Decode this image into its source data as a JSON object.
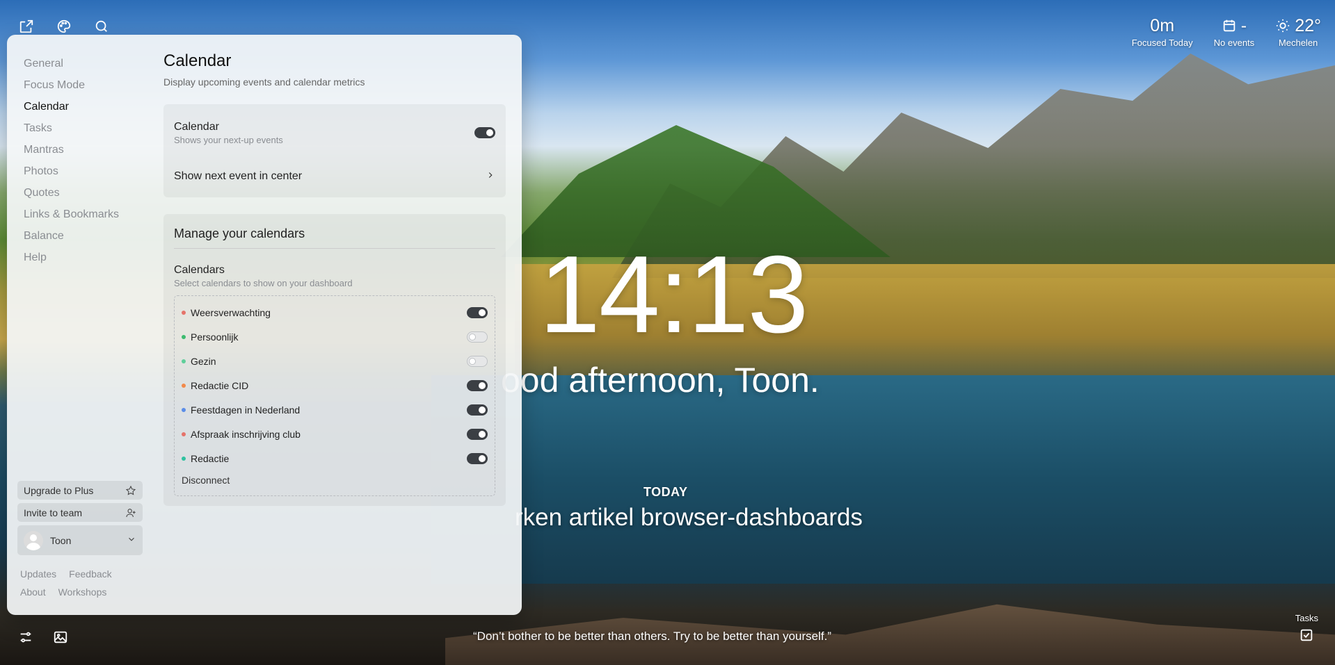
{
  "dashboard": {
    "clock": "14:13",
    "greeting": "ood afternoon, Toon.",
    "today_label": "TODAY",
    "focus_task": "rken artikel browser-dashboards",
    "quote": "“Don’t bother to be better than others. Try to be better than yourself.”",
    "tasks_label": "Tasks"
  },
  "widgets": {
    "focus": {
      "value": "0m",
      "label": "Focused Today"
    },
    "events": {
      "value": "-",
      "label": "No events",
      "icon": "calendar-icon"
    },
    "weather": {
      "value": "22°",
      "label": "Mechelen",
      "icon": "sun-icon"
    }
  },
  "nav": {
    "items": [
      {
        "label": "General"
      },
      {
        "label": "Focus Mode"
      },
      {
        "label": "Calendar"
      },
      {
        "label": "Tasks"
      },
      {
        "label": "Mantras"
      },
      {
        "label": "Photos"
      },
      {
        "label": "Quotes"
      },
      {
        "label": "Links & Bookmarks"
      },
      {
        "label": "Balance"
      },
      {
        "label": "Help"
      }
    ],
    "active": "Calendar"
  },
  "footer": {
    "upgrade": "Upgrade to Plus",
    "invite": "Invite to team",
    "user": "Toon",
    "links": [
      "Updates",
      "Feedback",
      "About",
      "Workshops"
    ]
  },
  "settings": {
    "title": "Calendar",
    "subtitle": "Display upcoming events and calendar metrics",
    "calendar_toggle": {
      "title": "Calendar",
      "subtitle": "Shows your next-up events",
      "on": true
    },
    "show_next": {
      "title": "Show next event in center"
    },
    "manage_title": "Manage your calendars",
    "calendars_title": "Calendars",
    "calendars_subtitle": "Select calendars to show on your dashboard",
    "calendars": [
      {
        "name": "Weersverwachting",
        "color": "#e5736a",
        "on": true
      },
      {
        "name": "Persoonlijk",
        "color": "#3dbb6f",
        "on": false
      },
      {
        "name": "Gezin",
        "color": "#5fcf9a",
        "on": false
      },
      {
        "name": "Redactie CID",
        "color": "#f28a4b",
        "on": true
      },
      {
        "name": "Feestdagen in Nederland",
        "color": "#5b8de8",
        "on": true
      },
      {
        "name": "Afspraak inschrijving club",
        "color": "#e5736a",
        "on": true
      },
      {
        "name": "Redactie",
        "color": "#2fc2a0",
        "on": true
      }
    ],
    "disconnect": "Disconnect"
  }
}
